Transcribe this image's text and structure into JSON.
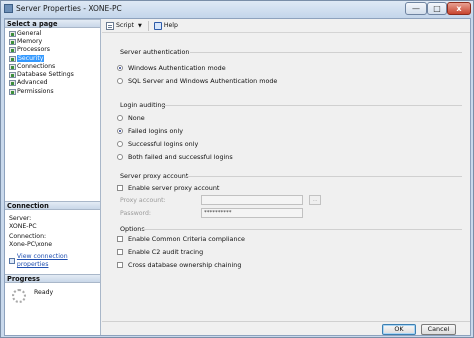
{
  "window": {
    "title": "Server Properties - XONE-PC",
    "min_label": "—",
    "max_label": "□",
    "close_label": "x"
  },
  "left_pane": {
    "select_page_header": "Select a page",
    "pages": [
      {
        "label": "General",
        "selected": false
      },
      {
        "label": "Memory",
        "selected": false
      },
      {
        "label": "Processors",
        "selected": false
      },
      {
        "label": "Security",
        "selected": true
      },
      {
        "label": "Connections",
        "selected": false
      },
      {
        "label": "Database Settings",
        "selected": false
      },
      {
        "label": "Advanced",
        "selected": false
      },
      {
        "label": "Permissions",
        "selected": false
      }
    ],
    "connection_header": "Connection",
    "server_label": "Server:",
    "server_value": "XONE-PC",
    "connection_label": "Connection:",
    "connection_value": "Xone-PC\\xone",
    "view_connection_link": "View connection properties",
    "progress_header": "Progress",
    "progress_status": "Ready"
  },
  "toolbar": {
    "script_label": "Script",
    "script_caret": "▼",
    "help_label": "Help"
  },
  "server_authentication": {
    "title": "Server authentication",
    "options": [
      {
        "label": "Windows Authentication mode",
        "selected": true
      },
      {
        "label": "SQL Server and Windows Authentication mode",
        "selected": false
      }
    ]
  },
  "login_auditing": {
    "title": "Login auditing",
    "options": [
      {
        "label": "None",
        "selected": false
      },
      {
        "label": "Failed logins only",
        "selected": true
      },
      {
        "label": "Successful logins only",
        "selected": false
      },
      {
        "label": "Both failed and successful logins",
        "selected": false
      }
    ]
  },
  "server_proxy": {
    "title": "Server proxy account",
    "enable_label": "Enable server proxy account",
    "enable_checked": false,
    "proxy_account_label": "Proxy account:",
    "proxy_account_value": "",
    "password_label": "Password:",
    "password_value": "**********",
    "browse_label": "..."
  },
  "options": {
    "title": "Options",
    "items": [
      {
        "label": "Enable Common Criteria compliance",
        "checked": false
      },
      {
        "label": "Enable C2 audit tracing",
        "checked": false
      },
      {
        "label": "Cross database ownership chaining",
        "checked": false
      }
    ]
  },
  "footer": {
    "ok_label": "OK",
    "cancel_label": "Cancel"
  }
}
